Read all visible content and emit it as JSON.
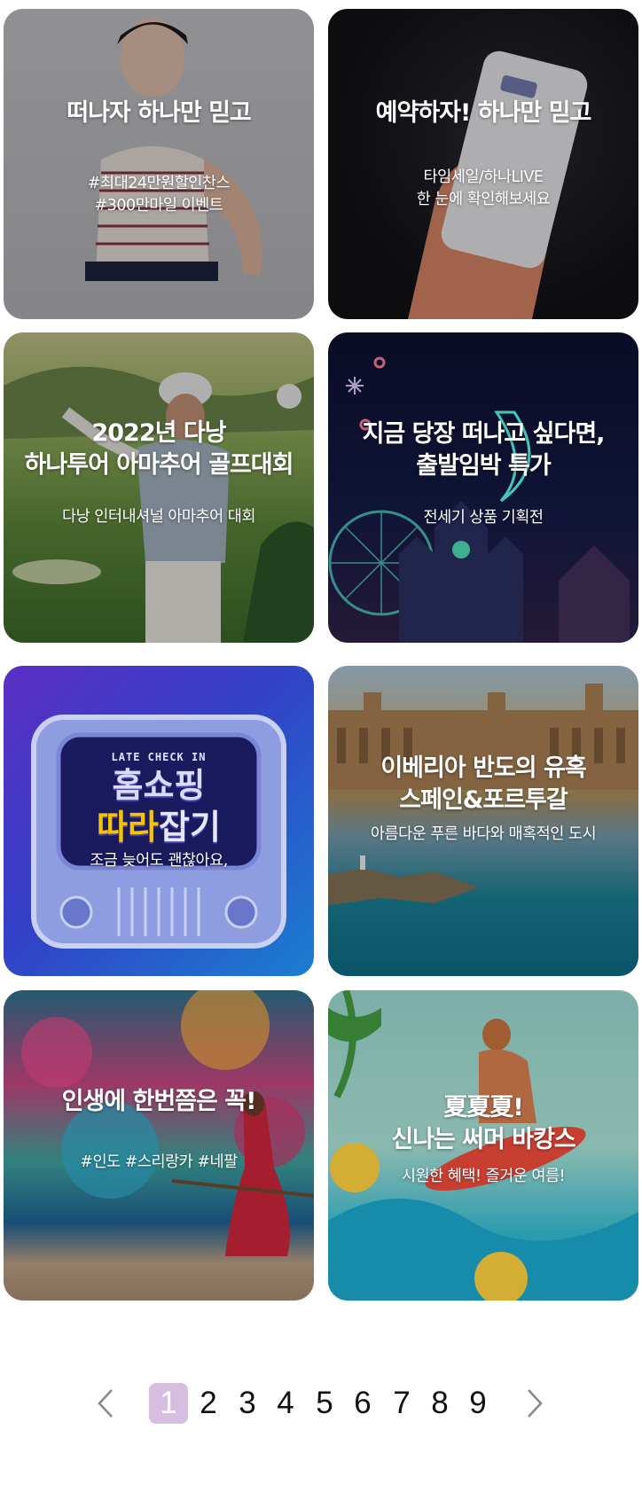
{
  "cards": [
    {
      "title": "떠나자 하나만 믿고",
      "subtitle": "#최대24만원할인찬스\n#300만마일 이벤트"
    },
    {
      "title": "예약하자! 하나만 믿고",
      "subtitle": "타임세일/하나LIVE\n한 눈에 확인해보세요"
    },
    {
      "title": "2022년 다낭\n하나투어 아마추어 골프대회",
      "subtitle": "다낭 인터내셔널 아마추어 대회"
    },
    {
      "title": "지금 당장 떠나고 싶다면,\n출발임박 특가",
      "subtitle": "전세기 상품 기획전"
    },
    {
      "title": "",
      "subtitle": "조금 늦어도 괜찮아요,",
      "art_top": "LATE CHECK IN",
      "art_line1": "홈쇼핑",
      "art_line2a": "따라",
      "art_line2b": "잡기"
    },
    {
      "title": "이베리아 반도의 유혹\n스페인&포르투갈",
      "subtitle": "아름다운 푸른 바다와 매혹적인 도시"
    },
    {
      "title": "인생에 한번쯤은 꼭!",
      "subtitle": "#인도 #스리랑카 #네팔"
    },
    {
      "title": "夏夏夏!\n신나는 써머 바캉스",
      "subtitle": "시원한 혜택! 즐거운 여름!"
    }
  ],
  "pagination": {
    "pages": [
      "1",
      "2",
      "3",
      "4",
      "5",
      "6",
      "7",
      "8",
      "9"
    ],
    "current": "1",
    "prev_icon": "chevron-left-icon",
    "next_icon": "chevron-right-icon",
    "active_color": "#d7bddf"
  }
}
